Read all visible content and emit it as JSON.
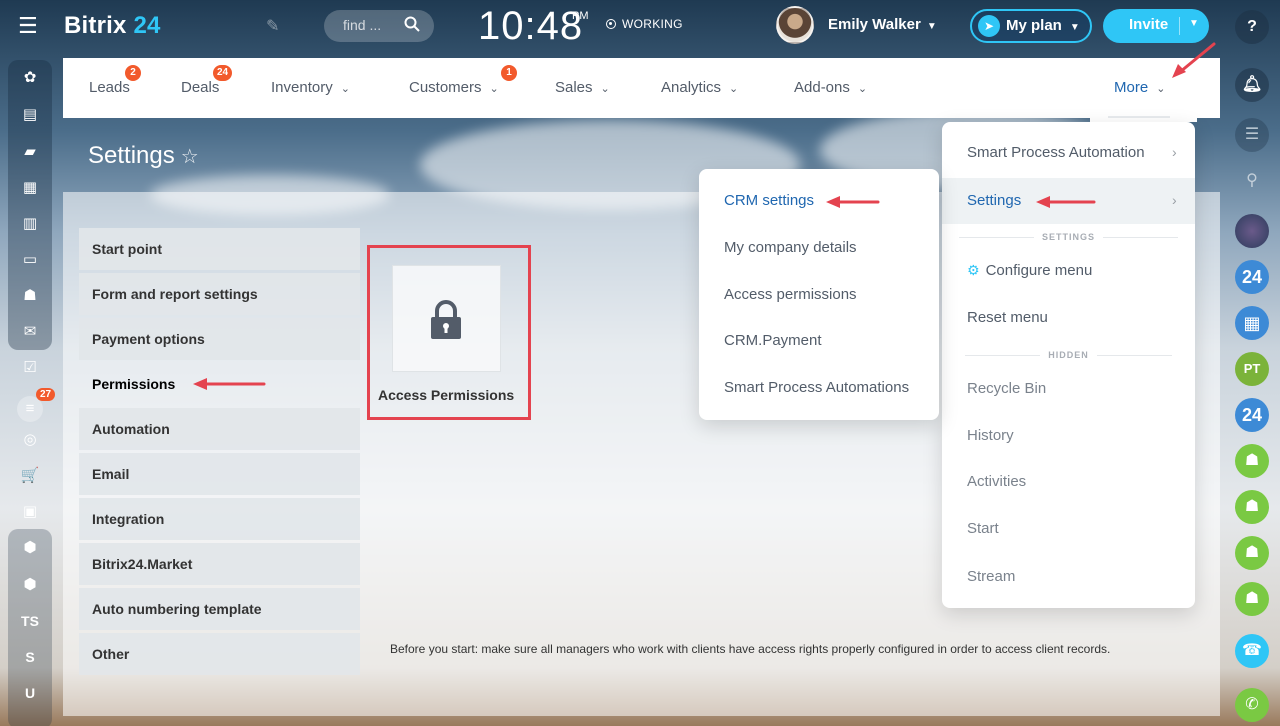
{
  "topbar": {
    "logo_text": "Bitrix",
    "logo_num": "24",
    "search_placeholder": "find ...",
    "clock": "10:48",
    "clock_suffix": "PM",
    "status": "WORKING",
    "user_name": "Emily Walker",
    "my_plan_label": "My plan",
    "invite_label": "Invite"
  },
  "navbar": {
    "items": [
      {
        "label": "Leads",
        "badge": "2"
      },
      {
        "label": "Deals",
        "badge": "24"
      },
      {
        "label": "Inventory"
      },
      {
        "label": "Customers",
        "badge": "1"
      },
      {
        "label": "Sales"
      },
      {
        "label": "Analytics"
      },
      {
        "label": "Add-ons"
      }
    ],
    "more_label": "More"
  },
  "page": {
    "title": "Settings"
  },
  "settings_menu": {
    "items": [
      "Start point",
      "Form and report settings",
      "Payment options",
      "Permissions",
      "Automation",
      "Email",
      "Integration",
      "Bitrix24.Market",
      "Auto numbering template",
      "Other"
    ]
  },
  "tile": {
    "label": "Access Permissions"
  },
  "note": "Before you start: make sure all managers who work with clients have access rights properly configured in order to access client records.",
  "more_menu": {
    "smart_process": "Smart Process Automation",
    "settings": "Settings",
    "section_settings": "SETTINGS",
    "configure_menu": "Configure menu",
    "reset_menu": "Reset menu",
    "section_hidden": "HIDDEN",
    "hidden_items": [
      "Recycle Bin",
      "History",
      "Activities",
      "Start",
      "Stream"
    ]
  },
  "crm_menu": {
    "items": [
      "CRM settings",
      "My company details",
      "Access permissions",
      "CRM.Payment",
      "Smart Process Automations"
    ]
  },
  "leftbar": {
    "badge": "27",
    "text_items": [
      "TS",
      "S",
      "U"
    ]
  },
  "rightbar": {
    "badges": [
      "24",
      "PT",
      "24"
    ]
  },
  "colors": {
    "accent": "#2fc6f6",
    "link": "#2067b0",
    "badge": "#f25a2c",
    "annotation": "#e4434f"
  }
}
